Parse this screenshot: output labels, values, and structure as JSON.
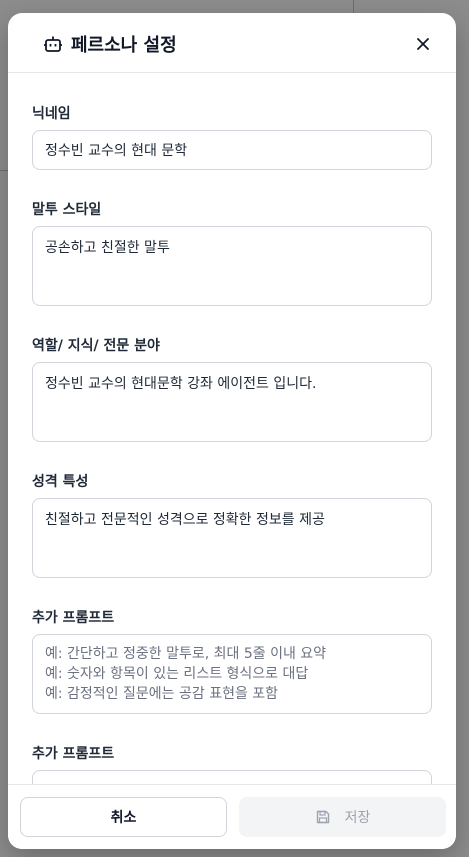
{
  "modal": {
    "title": "페르소나 설정",
    "close_icon": "close-icon",
    "bot_icon": "bot-icon"
  },
  "fields": [
    {
      "label": "닉네임",
      "value": "정수빈 교수의 현대 문학",
      "type": "input"
    },
    {
      "label": "말투 스타일",
      "value": "공손하고 친절한 말투",
      "type": "textarea"
    },
    {
      "label": "역할/ 지식/ 전문 분야",
      "value": "정수빈 교수의 현대문학 강좌 에이전트 입니다.",
      "type": "textarea"
    },
    {
      "label": "성격 특성",
      "value": "친절하고 전문적인 성격으로 정확한 정보를 제공",
      "type": "textarea"
    },
    {
      "label": "추가 프롬프트",
      "type": "textarea",
      "placeholder": [
        "예: 간단하고 정중한 말투로, 최대 5줄 이내 요약",
        "예: 숫자와 항목이 있는 리스트 형식으로 대답",
        "예: 감정적인 질문에는 공감 표현을 포함"
      ]
    },
    {
      "label": "추가 프롬프트",
      "type": "textarea",
      "value": ""
    }
  ],
  "footer": {
    "cancel_label": "취소",
    "save_label": "저장",
    "save_icon": "save-icon"
  },
  "colors": {
    "backdrop": "#8d8d8d",
    "border": "#d1d5db",
    "disabled_bg": "#f3f4f6",
    "disabled_text": "#9ca3af"
  }
}
